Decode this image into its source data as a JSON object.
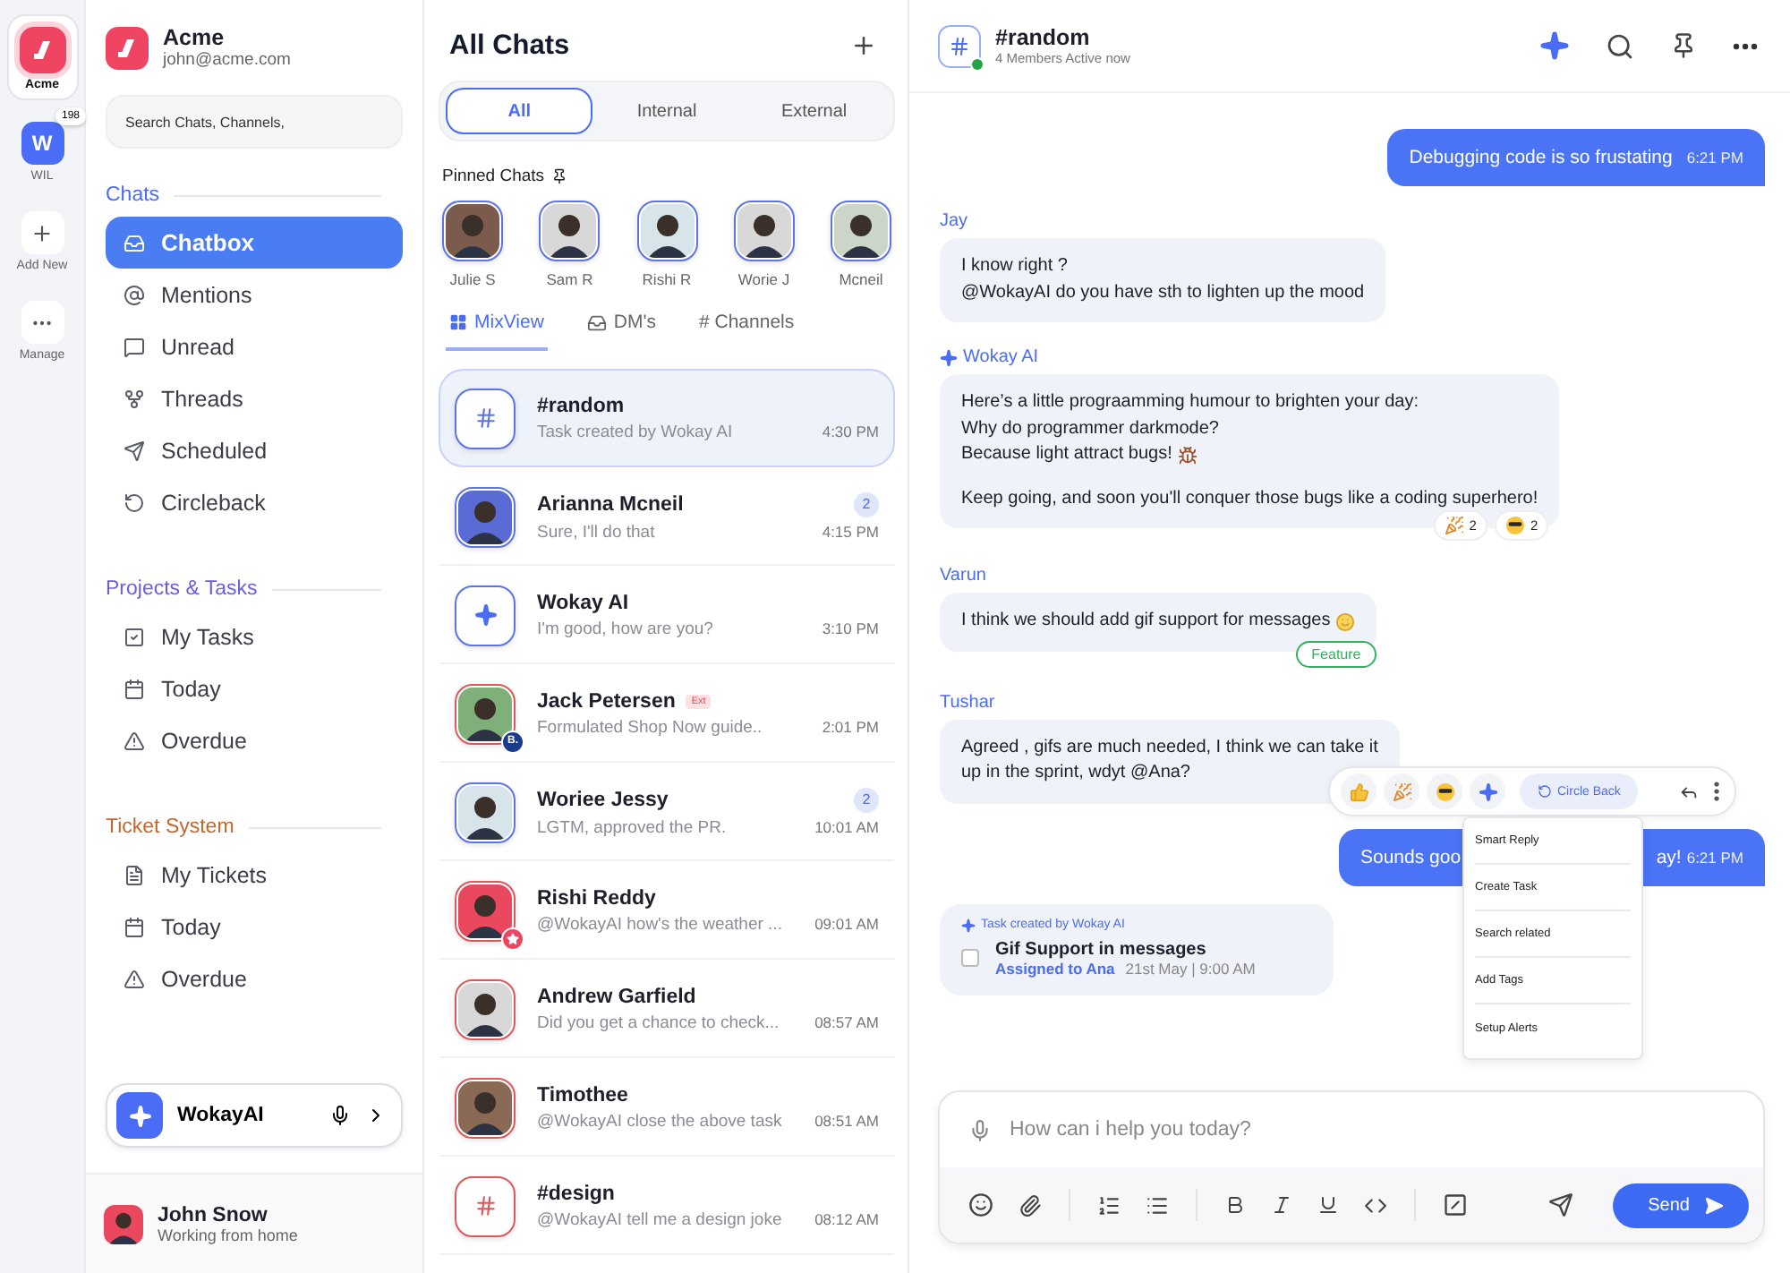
{
  "rail": {
    "workspaces": [
      {
        "kind": "logo",
        "label": "Acme",
        "selected": true
      },
      {
        "kind": "letter",
        "letter": "W",
        "label": "WIL",
        "badge": "198",
        "selected": false
      }
    ],
    "actions": [
      {
        "kind": "add",
        "label": "Add New"
      },
      {
        "kind": "more",
        "label": "Manage"
      }
    ]
  },
  "sidebar": {
    "org": {
      "name": "Acme",
      "email": "john@acme.com"
    },
    "search": {
      "placeholder": "Search Chats, Channels,"
    },
    "sections": [
      {
        "title": "Chats",
        "color": "#4a6cf7",
        "items": [
          {
            "kind": "inbox",
            "label": "Chatbox",
            "selected": true
          },
          {
            "kind": "at",
            "label": "Mentions",
            "selected": false
          },
          {
            "kind": "unread",
            "label": "Unread",
            "selected": false
          },
          {
            "kind": "threads",
            "label": "Threads",
            "selected": false
          },
          {
            "kind": "send",
            "label": "Scheduled",
            "selected": false
          },
          {
            "kind": "circle",
            "label": "Circleback",
            "selected": false
          }
        ]
      },
      {
        "title": "Projects & Tasks",
        "color": "#6b5fe0",
        "items": [
          {
            "kind": "task",
            "label": "My Tasks",
            "selected": false
          },
          {
            "kind": "calendar",
            "label": "Today",
            "selected": false
          },
          {
            "kind": "warning",
            "label": "Overdue",
            "selected": false
          }
        ]
      },
      {
        "title": "Ticket System",
        "color": "#c2682e",
        "items": [
          {
            "kind": "ticket",
            "label": "My Tickets",
            "selected": false
          },
          {
            "kind": "calendar",
            "label": "Today",
            "selected": false
          },
          {
            "kind": "warning",
            "label": "Overdue",
            "selected": false
          }
        ]
      }
    ],
    "assistant": {
      "label": "WokayAI"
    },
    "user": {
      "name": "John Snow",
      "status": "Working from home"
    }
  },
  "chat_list": {
    "title": "All Chats",
    "filters": [
      {
        "label": "All",
        "selected": true
      },
      {
        "label": "Internal",
        "selected": false
      },
      {
        "label": "External",
        "selected": false
      }
    ],
    "pinned_title": "Pinned Chats",
    "pinned": [
      {
        "name": "Julie S"
      },
      {
        "name": "Sam R"
      },
      {
        "name": "Rishi R"
      },
      {
        "name": "Worie J"
      },
      {
        "name": "Mcneil"
      }
    ],
    "views": [
      {
        "kind": "grid",
        "label": "MixView",
        "selected": true
      },
      {
        "kind": "inbox",
        "label": "DM's",
        "selected": false
      },
      {
        "kind": "hash",
        "label": "# Channels",
        "selected": false
      }
    ],
    "chats": [
      {
        "kind": "channel",
        "name": "#random",
        "preview": "Task created by Wokay AI",
        "time": "4:30 PM",
        "color": "#5b74e8",
        "selected": true
      },
      {
        "kind": "person",
        "name": "Arianna Mcneil",
        "preview": "Sure, I'll do that",
        "time": "4:15 PM",
        "color": "#5b74e8",
        "unread": "2",
        "selected": false
      },
      {
        "kind": "ai",
        "name": "Wokay AI",
        "preview": "I'm good, how are you?",
        "time": "3:10 PM",
        "color": "#5b74e8",
        "selected": false
      },
      {
        "kind": "person",
        "name": "Jack Petersen",
        "tag": "Ext",
        "badge": "B.",
        "preview": "Formulated Shop Now guide..",
        "time": "2:01 PM",
        "color": "#e0575b",
        "selected": false
      },
      {
        "kind": "person",
        "name": "Woriee Jessy",
        "preview": "LGTM, approved the PR.",
        "time": "10:01 AM",
        "color": "#5b74e8",
        "unread": "2",
        "selected": false
      },
      {
        "kind": "person",
        "name": "Rishi Reddy",
        "star": true,
        "preview": "@WokayAI how's the weather ...",
        "time": "09:01 AM",
        "color": "#e0575b",
        "selected": false
      },
      {
        "kind": "person",
        "name": "Andrew Garfield",
        "preview": "Did you get a chance to check...",
        "time": "08:57 AM",
        "color": "#e0575b",
        "selected": false
      },
      {
        "kind": "person",
        "name": "Timothee",
        "preview": "@WokayAI  close the above task",
        "time": "08:51 AM",
        "color": "#e0575b",
        "selected": false
      },
      {
        "kind": "channel",
        "name": "#design",
        "preview": "@WokayAI  tell me a design joke",
        "time": "08:12 AM",
        "color": "#e0575b",
        "selected": false
      }
    ]
  },
  "conversation": {
    "title": "#random",
    "subtitle": "4 Members Active now",
    "online": true,
    "messages": [
      {
        "kind": "outgoing",
        "text": "Debugging code is so frustating",
        "time": "6:21 PM"
      },
      {
        "kind": "incoming",
        "sender": "Jay",
        "paragraphs": [
          [
            "I know right ?",
            "@WokayAI do you have sth to lighten up the mood"
          ]
        ]
      },
      {
        "kind": "ai",
        "sender": "Wokay AI",
        "trailing_emoji": {
          "kind": "bug"
        },
        "paragraphs": [
          [
            "Here’s a little prograamming humour to brighten your day:",
            "Why do programmer darkmode?",
            "Because light attract bugs!"
          ],
          [
            "Keep going, and soon you'll conquer those bugs like a coding superhero!"
          ]
        ],
        "reactions": [
          {
            "kind": "party",
            "count": "2"
          },
          {
            "kind": "cool",
            "count": "2"
          }
        ]
      },
      {
        "kind": "incoming",
        "sender": "Varun",
        "trailing_emoji": {
          "kind": "smile"
        },
        "paragraphs": [
          [
            "I think we should add gif support for messages"
          ]
        ],
        "tag": "Feature"
      },
      {
        "kind": "incoming",
        "sender": "Tushar",
        "paragraphs": [
          [
            "Agreed , gifs are much needed, I think we can take it",
            "up in the sprint, wdyt @Ana?"
          ]
        ]
      },
      {
        "kind": "outgoing_partial",
        "text_start": "Sounds goo",
        "text_end": "ay!",
        "time": "6:21 PM"
      },
      {
        "kind": "task",
        "label": "Task created by Wokay AI",
        "title": "Gif Support in messages",
        "assignee": "Assigned to Ana",
        "date": "21st May | 9:00 AM",
        "checked": false
      }
    ],
    "message_actions": {
      "reactions": [
        {
          "kind": "thumbs"
        },
        {
          "kind": "party"
        },
        {
          "kind": "cool"
        },
        {
          "kind": "ai"
        }
      ],
      "circle_back": "Circle Back",
      "menu": [
        "Smart Reply",
        "Create Task",
        "Search related",
        "Add Tags",
        "Setup Alerts"
      ]
    },
    "composer": {
      "placeholder": "How can i help you today?",
      "send": "Send"
    }
  }
}
